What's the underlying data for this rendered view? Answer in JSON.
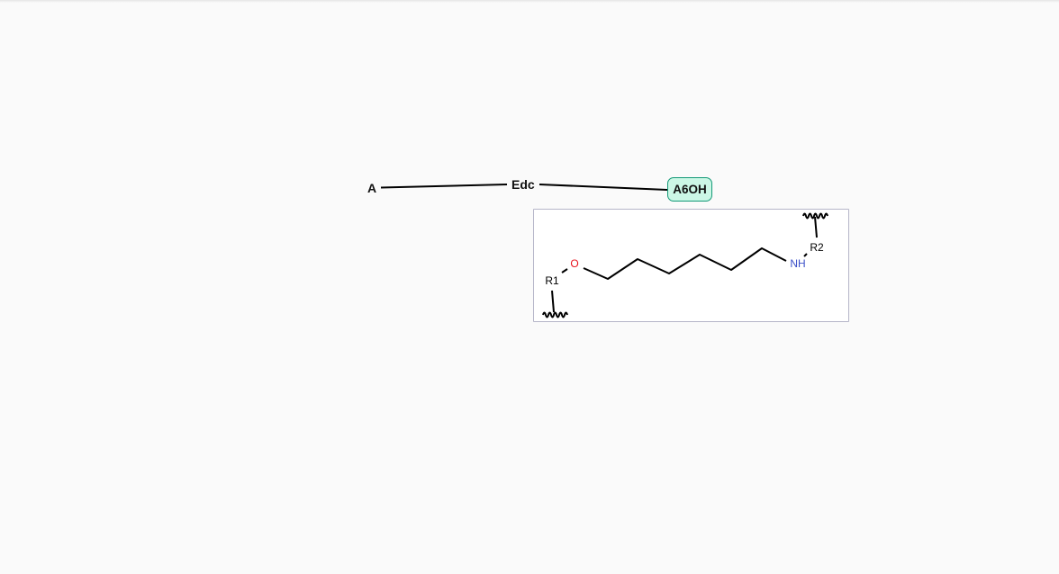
{
  "graph": {
    "nodes": [
      {
        "id": "A",
        "label": "A"
      },
      {
        "id": "Edc",
        "label": "Edc"
      },
      {
        "id": "A6OH",
        "label": "A6OH",
        "highlight_fill": "#ccf7e6",
        "highlight_border": "#139977"
      }
    ],
    "edges": [
      {
        "from": "A",
        "to": "Edc"
      },
      {
        "from": "Edc",
        "to": "A6OH"
      }
    ]
  },
  "structure": {
    "atoms": {
      "oxygen": "O",
      "nitrogen": "NH",
      "r1": "R1",
      "r2": "R2"
    },
    "colors": {
      "oxygen": "#e8141e",
      "nitrogen": "#3b50c8",
      "bond": "#000000"
    }
  }
}
